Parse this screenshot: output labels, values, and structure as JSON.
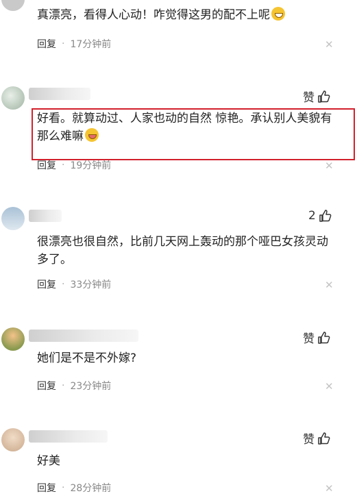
{
  "comments": [
    {
      "text": "真漂亮，看得人心动！咋觉得这男的配不上呢",
      "reply": "回复",
      "dot": "·",
      "time": "17分钟前",
      "like_label": "",
      "like_count": ""
    },
    {
      "text": "好看。就算动过、人家也动的自然 惊艳。承认别人美貌有那么难嘛",
      "reply": "回复",
      "dot": "·",
      "time": "19分钟前",
      "like_label": "赞",
      "like_count": ""
    },
    {
      "text": "很漂亮也很自然，比前几天网上轰动的那个哑巴女孩灵动多了。",
      "reply": "回复",
      "dot": "·",
      "time": "33分钟前",
      "like_label": "",
      "like_count": "2"
    },
    {
      "text": "她们是不是不外嫁?",
      "reply": "回复",
      "dot": "·",
      "time": "23分钟前",
      "like_label": "赞",
      "like_count": ""
    },
    {
      "text": "好美",
      "reply": "回复",
      "dot": "·",
      "time": "28分钟前",
      "like_label": "赞",
      "like_count": ""
    }
  ],
  "icons": {
    "like": "thumbs-up-icon",
    "close": "close-icon",
    "emoji": "emoji-icon"
  },
  "colors": {
    "highlight": "#d21f2b",
    "muted": "#888888"
  }
}
